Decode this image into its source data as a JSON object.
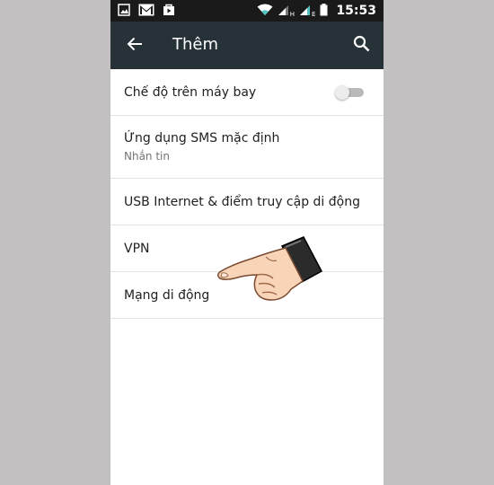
{
  "status_bar": {
    "time": "15:53",
    "network_labels": [
      "H",
      "E"
    ]
  },
  "app_bar": {
    "title": "Thêm",
    "back_icon": "arrow-left-icon",
    "search_icon": "search-icon",
    "background": "#263238"
  },
  "settings": [
    {
      "title": "Chế độ trên máy bay",
      "toggle": "off"
    },
    {
      "title": "Ứng dụng SMS mặc định",
      "subtitle": "Nhắn tin"
    },
    {
      "title": "USB Internet & điểm truy cập di động"
    },
    {
      "title": "VPN"
    },
    {
      "title": "Mạng di động"
    }
  ],
  "colors": {
    "page_background": "#c2c0c1",
    "status_bar": "#1a1a1a",
    "wifi_accent": "#52c3c0"
  }
}
